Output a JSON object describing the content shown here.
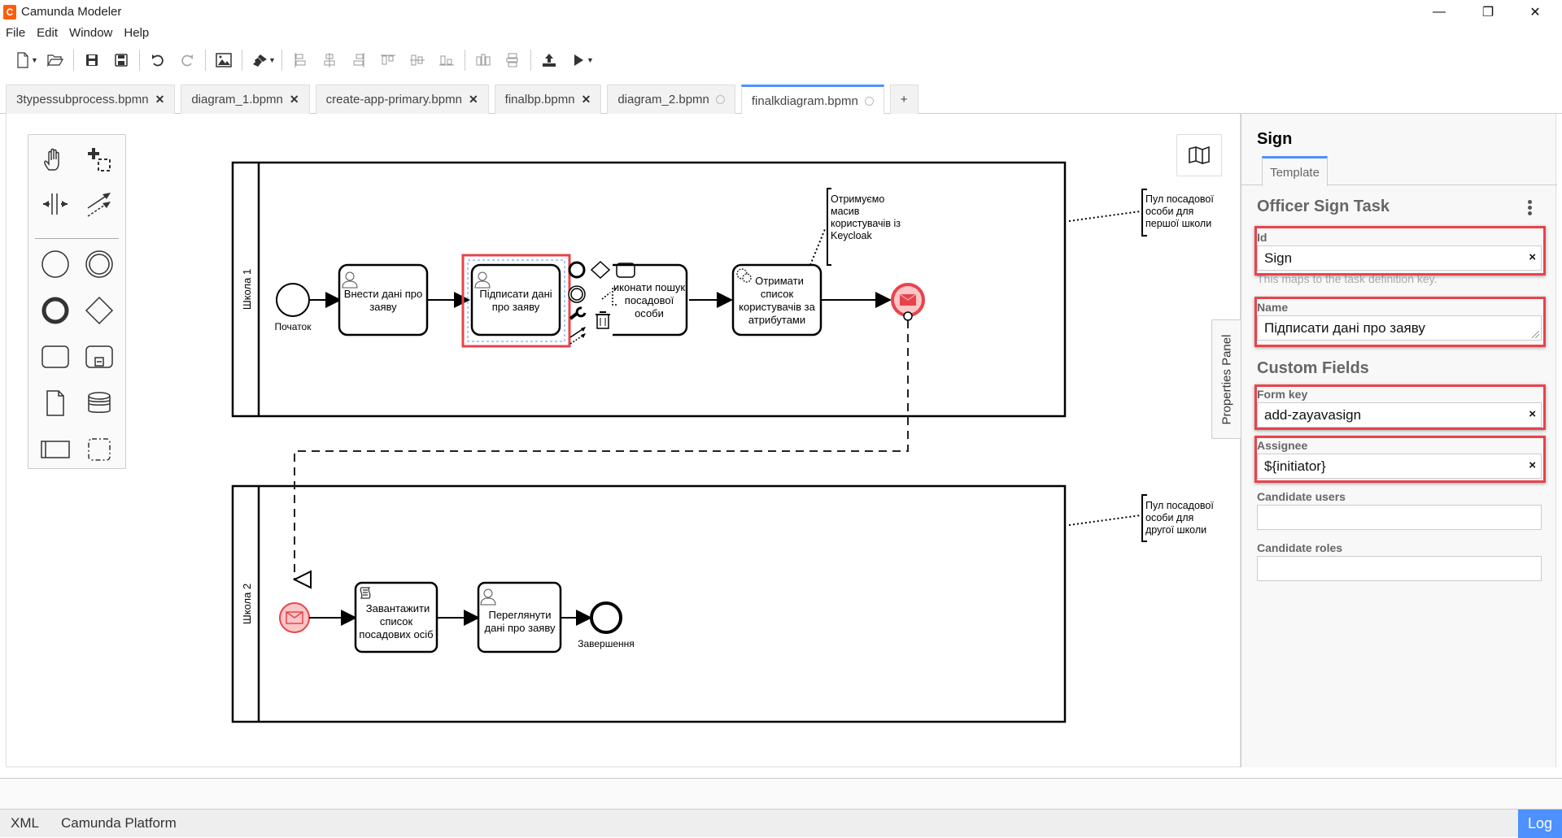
{
  "window": {
    "title": "Camunda Modeler",
    "logo_glyph": "C",
    "controls": {
      "minimize": "—",
      "maximize": "❐",
      "close": "✕"
    }
  },
  "menu": [
    "File",
    "Edit",
    "Window",
    "Help"
  ],
  "toolbar": {
    "groups": [
      [
        "new-file-icon",
        "open-file-icon"
      ],
      [
        "save-icon",
        "save-as-icon"
      ],
      [
        "undo-icon",
        "redo-icon"
      ],
      [
        "export-image-icon"
      ],
      [
        "color-brush-icon"
      ],
      [
        "align-left-icon",
        "align-center-icon",
        "align-right-icon",
        "align-top-icon",
        "align-middle-icon",
        "align-bottom-icon"
      ],
      [
        "distribute-horizontal-icon",
        "distribute-vertical-icon"
      ],
      [
        "deploy-icon",
        "run-icon"
      ]
    ]
  },
  "tabs": [
    {
      "label": "3typessubprocess.bpmn",
      "state": "saved"
    },
    {
      "label": "diagram_1.bpmn",
      "state": "saved"
    },
    {
      "label": "create-app-primary.bpmn",
      "state": "saved"
    },
    {
      "label": "finalbp.bpmn",
      "state": "saved"
    },
    {
      "label": "diagram_2.bpmn",
      "state": "unsaved"
    },
    {
      "label": "finalkdiagram.bpmn",
      "state": "unsaved",
      "active": true
    }
  ],
  "add_tab_label": "+",
  "palette": [
    "hand-tool-icon",
    "lasso-tool-icon",
    "space-tool-icon",
    "global-connect-icon",
    "start-event-icon",
    "intermediate-event-icon",
    "end-event-icon",
    "gateway-icon",
    "task-icon",
    "subprocess-icon",
    "data-object-icon",
    "data-store-icon",
    "pool-icon",
    "group-icon"
  ],
  "diagram": {
    "pools": [
      {
        "name": "Школа 1"
      },
      {
        "name": "Школа 2"
      }
    ],
    "elements": {
      "start": "Початок",
      "task_enter": "Внести дані про заяву",
      "task_sign": "Підписати дані про заяву",
      "task_search": "Виконати пошук посадової особи",
      "task_search_visible": "иконати пошук посадової особи",
      "task_get_list": "Отримати список користувачів за атрибутами",
      "annotation_keycloak": "Отримуємо масив користувачів із Keycloak",
      "annotation_pool1": "Пул посадової особи для першої школи",
      "annotation_pool2": "Пул посадової особи для другої школи",
      "task_load": "Завантажити список посадових осіб",
      "task_review": "Переглянути дані про заяву",
      "end": "Завершення"
    },
    "message_color": "#e8434b",
    "selection_color": "#e8434b"
  },
  "properties": {
    "toggle_label": "Properties Panel",
    "title": "Sign",
    "tab": "Template",
    "template_name": "Officer Sign Task",
    "fields": {
      "id": {
        "label": "Id",
        "value": "Sign",
        "hint": "This maps to the task definition key."
      },
      "name": {
        "label": "Name",
        "value": "Підписати дані про заяву"
      }
    },
    "custom_fields_heading": "Custom Fields",
    "custom": {
      "form_key": {
        "label": "Form key",
        "value": "add-zayavasign"
      },
      "assignee": {
        "label": "Assignee",
        "value": "${initiator}"
      },
      "candidate_users": {
        "label": "Candidate users",
        "value": ""
      },
      "candidate_roles": {
        "label": "Candidate roles",
        "value": ""
      }
    },
    "clear_glyph": "×"
  },
  "status": {
    "xml": "XML",
    "platform": "Camunda Platform",
    "log": "Log"
  }
}
